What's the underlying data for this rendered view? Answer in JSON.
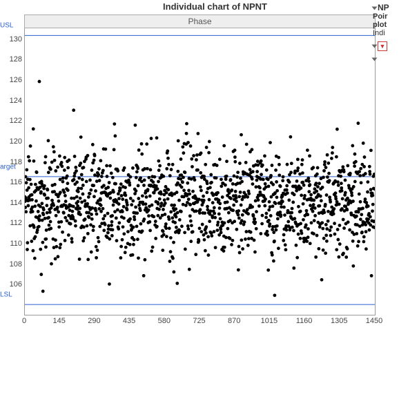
{
  "chart_data": {
    "type": "scatter",
    "title": "Individual chart of NPNT",
    "phase_label": "Phase",
    "xlabel": "",
    "ylabel": "",
    "xlim": [
      0,
      1450
    ],
    "ylim": [
      104,
      132
    ],
    "x_ticks": [
      0,
      145,
      290,
      435,
      580,
      725,
      870,
      1015,
      1160,
      1305,
      1450
    ],
    "y_ticks": [
      106,
      108,
      110,
      112,
      114,
      116,
      118,
      120,
      122,
      124,
      126,
      128,
      130
    ],
    "reference_lines": [
      {
        "label": "USL",
        "y": 131.3,
        "color": "#2a5fd0"
      },
      {
        "label": "arget",
        "y": 117.5,
        "color": "#2a5fd0"
      },
      {
        "label": "LSL",
        "y": 105.0,
        "color": "#2a5fd0"
      }
    ],
    "n_points": 1450,
    "distribution": {
      "mean": 115.0,
      "sd": 2.6,
      "seed": 42,
      "outliers": [
        {
          "x": 60,
          "y": 126.8
        },
        {
          "x": 1035,
          "y": 105.9
        },
        {
          "x": 75,
          "y": 106.3
        }
      ]
    }
  },
  "side_panel": {
    "header": "NP",
    "line1": "Poir",
    "line2": "plot",
    "line3": "Indi"
  }
}
